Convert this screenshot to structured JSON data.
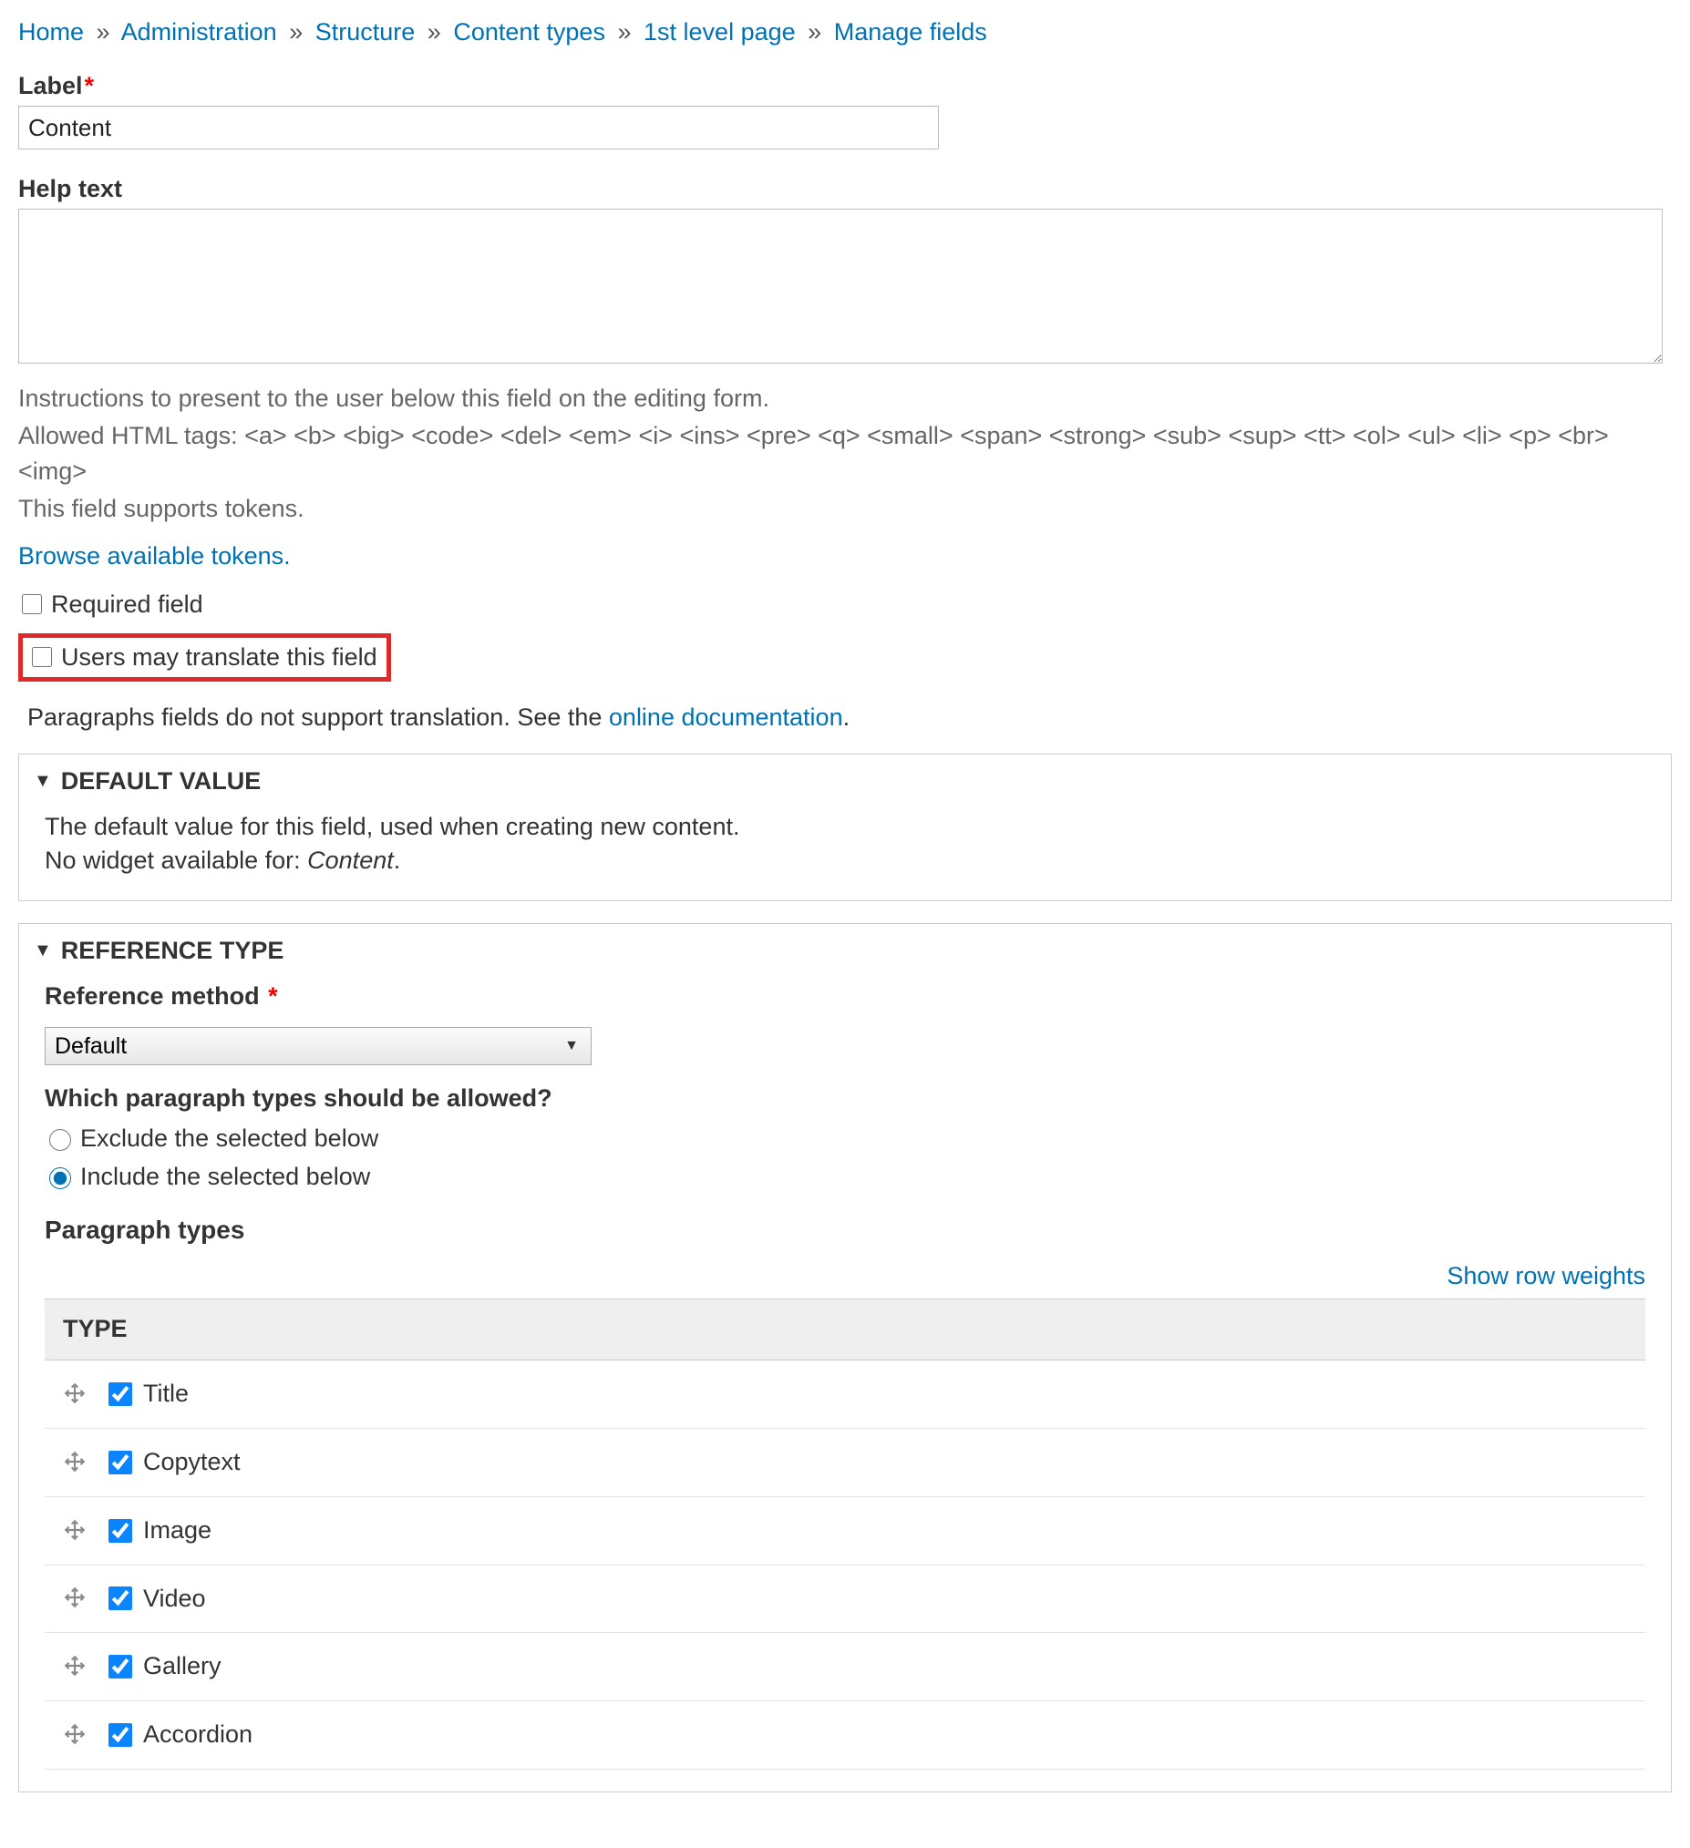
{
  "breadcrumb": [
    {
      "label": "Home"
    },
    {
      "label": "Administration"
    },
    {
      "label": "Structure"
    },
    {
      "label": "Content types"
    },
    {
      "label": "1st level page"
    },
    {
      "label": "Manage fields"
    }
  ],
  "label_field": {
    "label": "Label",
    "value": "Content"
  },
  "help_text": {
    "label": "Help text",
    "value": "",
    "desc1": "Instructions to present to the user below this field on the editing form.",
    "desc2": "Allowed HTML tags: <a> <b> <big> <code> <del> <em> <i> <ins> <pre> <q> <small> <span> <strong> <sub> <sup> <tt> <ol> <ul> <li> <p> <br> <img>",
    "desc3": "This field supports tokens."
  },
  "tokens_link": "Browse available tokens.",
  "required_field_label": "Required field",
  "translate_field_label": "Users may translate this field",
  "translation_note": {
    "prefix": "Paragraphs fields do not support translation. See the ",
    "link": "online documentation",
    "suffix": "."
  },
  "default_value": {
    "title": "DEFAULT VALUE",
    "line1": "The default value for this field, used when creating new content.",
    "line2_prefix": "No widget available for: ",
    "line2_italic": "Content",
    "line2_suffix": "."
  },
  "reference_type": {
    "title": "REFERENCE TYPE",
    "method_label": "Reference method",
    "method_value": "Default",
    "which_label": "Which paragraph types should be allowed?",
    "radio_exclude": "Exclude the selected below",
    "radio_include": "Include the selected below",
    "paragraph_types_label": "Paragraph types",
    "show_row_weights": "Show row weights",
    "type_header": "TYPE",
    "rows": [
      {
        "label": "Title",
        "checked": true
      },
      {
        "label": "Copytext",
        "checked": true
      },
      {
        "label": "Image",
        "checked": true
      },
      {
        "label": "Video",
        "checked": true
      },
      {
        "label": "Gallery",
        "checked": true
      },
      {
        "label": "Accordion",
        "checked": true
      }
    ]
  }
}
